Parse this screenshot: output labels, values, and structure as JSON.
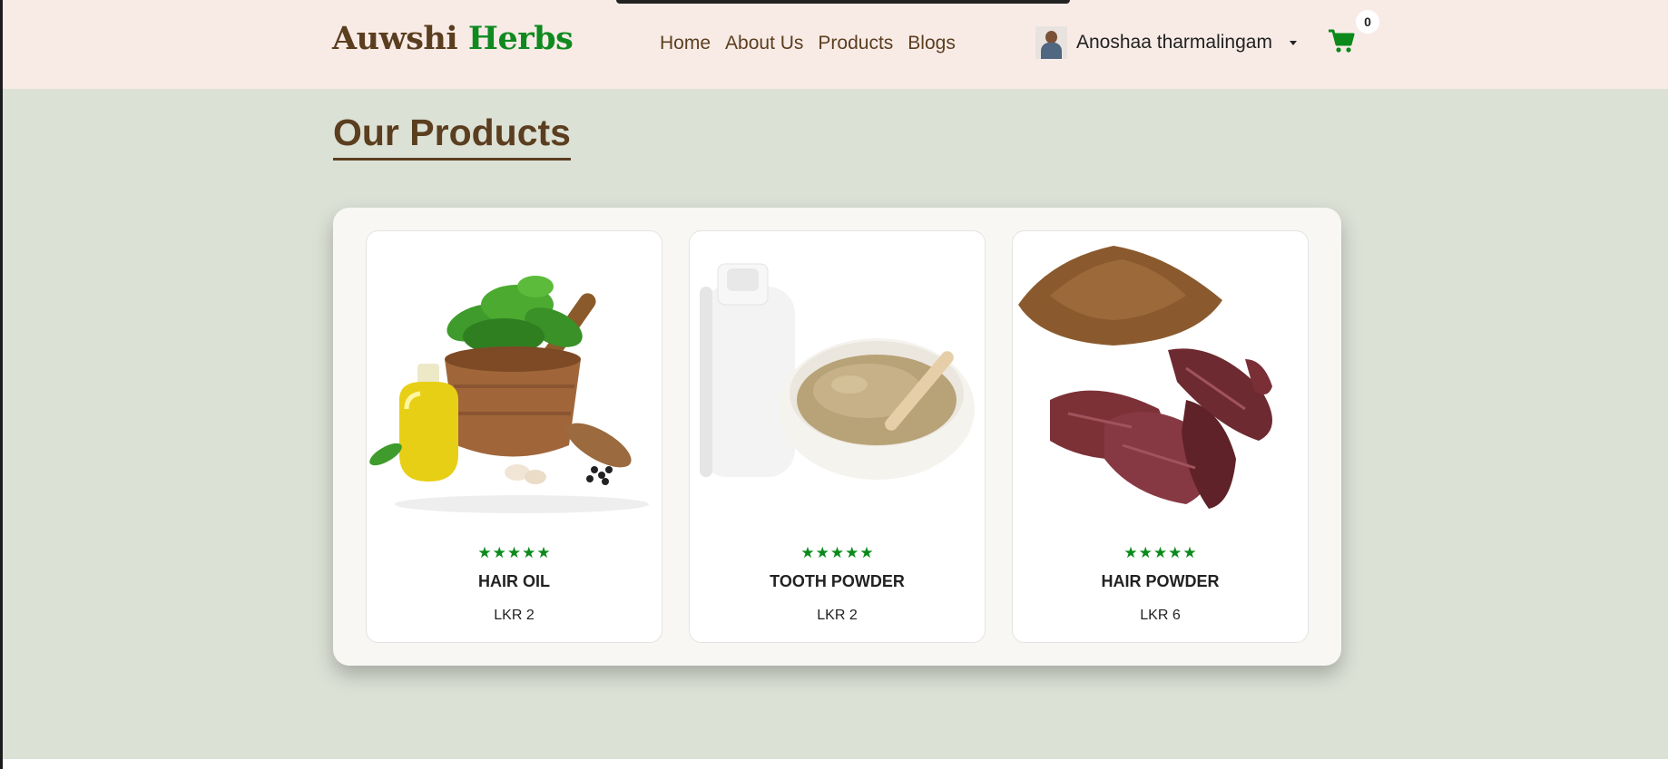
{
  "brand": {
    "part1": "Auwshi",
    "part2": "Herbs"
  },
  "nav": {
    "items": [
      "Home",
      "About Us",
      "Products",
      "Blogs"
    ]
  },
  "user": {
    "name": "Anoshaa tharmalingam"
  },
  "cart": {
    "count": "0"
  },
  "page": {
    "title": "Our Products"
  },
  "products": [
    {
      "name": "HAIR OIL",
      "price": "LKR 2",
      "rating": 5,
      "image": "herbs-oil-mortar"
    },
    {
      "name": "TOOTH POWDER",
      "price": "LKR 2",
      "rating": 5,
      "image": "powder-bowl"
    },
    {
      "name": "HAIR POWDER",
      "price": "LKR 6",
      "rating": 5,
      "image": "powder-dried-roots"
    }
  ],
  "colors": {
    "brand_brown": "#5b3e1f",
    "brand_green": "#0f8a1f",
    "header_bg": "#f8ebe6",
    "page_bg": "#dce1d6",
    "star": "#0b8a1b"
  },
  "icons": {
    "cart": "cart-icon",
    "star": "star-icon",
    "caret": "caret-down-icon"
  }
}
